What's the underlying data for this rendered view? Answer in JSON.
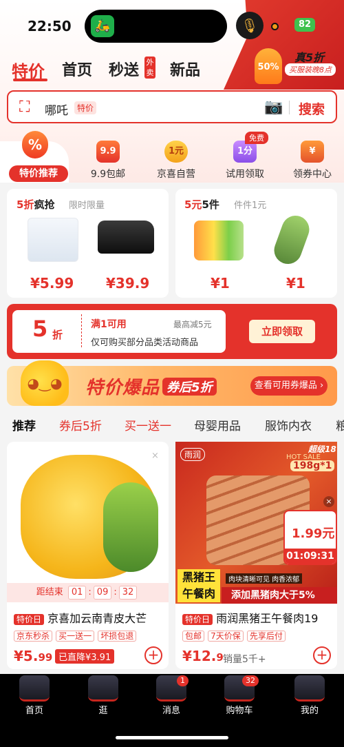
{
  "status": {
    "time": "22:50",
    "battery": "82"
  },
  "top_tabs": [
    {
      "label": "特价"
    },
    {
      "label": "首页"
    },
    {
      "label": "秒送"
    },
    {
      "label": "新品"
    }
  ],
  "waisong_tag": "外卖",
  "promo": {
    "badge": "50%",
    "title": "真5折",
    "sub": "买服装晚8点"
  },
  "search": {
    "placeholder": "哪吒",
    "tag": "特价",
    "button": "搜索"
  },
  "categories": [
    {
      "label": "特价推荐",
      "icon": "percent-icon"
    },
    {
      "label": "9.9包邮",
      "icon_text": "9.9"
    },
    {
      "label": "京喜自营",
      "icon_text": "1元"
    },
    {
      "label": "试用领取",
      "icon_text": "1分",
      "badge": "免费"
    },
    {
      "label": "领券中心",
      "icon_text": "¥"
    }
  ],
  "panels": {
    "left": {
      "title_red": "5折",
      "title_rest": "疯抢",
      "sub": "限时限量",
      "prices": [
        "¥5.99",
        "¥39.9"
      ]
    },
    "right": {
      "title_red": "5元",
      "title_rest": "5件",
      "sub": "件件1元",
      "prices": [
        "¥1",
        "¥1"
      ]
    }
  },
  "coupon": {
    "discount": "5",
    "unit": "折",
    "condition": "满1可用",
    "max": "最高减5元",
    "desc": "仅可购买部分品类活动商品",
    "button": "立即领取"
  },
  "banner": {
    "title": "特价爆品",
    "after": "券后5折",
    "button": "查看可用券爆品 ›"
  },
  "feed_tabs": [
    "推荐",
    "券后5折",
    "买一送一",
    "母婴用品",
    "服饰内衣",
    "粮"
  ],
  "products": [
    {
      "countdown_label": "距结束",
      "countdown": [
        "01",
        "09",
        "32"
      ],
      "tday": "特价日",
      "name": "京喜加云南青皮大芒",
      "tags": [
        "京东秒杀",
        "买一送一",
        "坏损包退"
      ],
      "price_int": "¥5.",
      "price_dec": "99",
      "drop": "已直降¥3.91"
    },
    {
      "super": "超级18",
      "weight": "198g*1",
      "hot": "HOT SALE",
      "brand": "雨润",
      "big_label": "黑猪王午餐肉",
      "side_price": "1.99元",
      "side_time": "01:09:31",
      "caption": "肉块清晰可见 肉香浓郁",
      "strip": "添加黑猪肉大于5%",
      "tday": "特价日",
      "name": "雨润黑猪王午餐肉19",
      "tags": [
        "包邮",
        "7天价保",
        "先享后付"
      ],
      "price_int": "¥12.",
      "price_dec": "9",
      "sales": "销量5千+"
    }
  ],
  "bottom_nav": [
    {
      "label": "首页"
    },
    {
      "label": "逛"
    },
    {
      "label": "消息",
      "badge": "1"
    },
    {
      "label": "购物车",
      "badge": "32"
    },
    {
      "label": "我的"
    }
  ]
}
